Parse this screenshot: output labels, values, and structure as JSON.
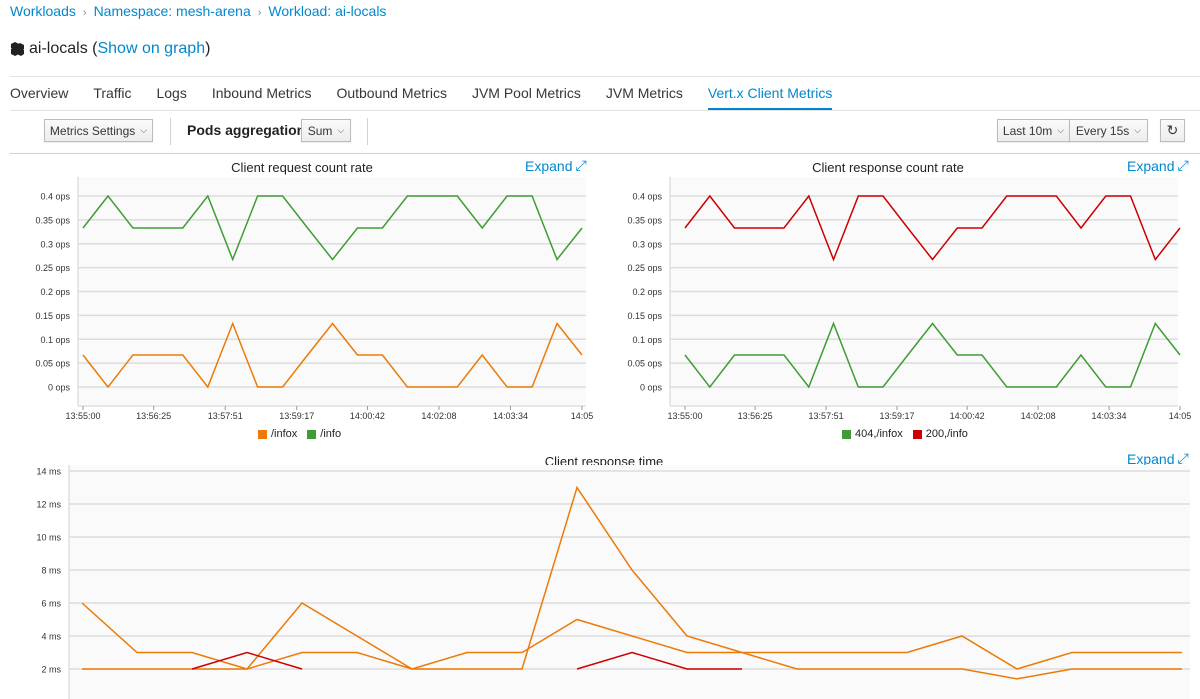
{
  "breadcrumb": [
    "Workloads",
    "Namespace: mesh-arena",
    "Workload: ai-locals"
  ],
  "title": {
    "name": "ai-locals",
    "open_paren": "(",
    "link": "Show on graph",
    "close_paren": ")",
    "icon": "cubes-icon"
  },
  "tabs": [
    {
      "label": "Overview",
      "active": false
    },
    {
      "label": "Traffic",
      "active": false
    },
    {
      "label": "Logs",
      "active": false
    },
    {
      "label": "Inbound Metrics",
      "active": false
    },
    {
      "label": "Outbound Metrics",
      "active": false
    },
    {
      "label": "JVM Pool Metrics",
      "active": false
    },
    {
      "label": "JVM Metrics",
      "active": false
    },
    {
      "label": "Vert.x Client Metrics",
      "active": true
    }
  ],
  "toolbar": {
    "metrics_settings": "Metrics Settings",
    "pods_aggregation_label": "Pods aggregation",
    "pods_aggregation_value": "Sum",
    "duration": "Last 10m",
    "refresh_interval": "Every 15s",
    "refresh_icon": "refresh-icon"
  },
  "expand_label": "Expand",
  "colors": {
    "accent": "#0088ce",
    "orange": "#ec7a08",
    "green": "#3f9c35",
    "red": "#cc0000"
  },
  "chart_data": [
    {
      "type": "line",
      "title": "Client request count rate",
      "x": [
        "13:55:00",
        "13:55:30",
        "13:56:00",
        "13:56:30",
        "13:57:00",
        "13:57:30",
        "13:58:00",
        "13:58:30",
        "13:59:00",
        "13:59:30",
        "14:00:00",
        "14:00:30",
        "14:01:00",
        "14:01:30",
        "14:02:00",
        "14:02:30",
        "14:03:00",
        "14:03:30",
        "14:04:00",
        "14:04:30",
        "14:05:00"
      ],
      "xticks": [
        "13:55:00",
        "13:56:25",
        "13:57:51",
        "13:59:17",
        "14:00:42",
        "14:02:08",
        "14:03:34",
        "14:05"
      ],
      "yticks": [
        "0 ops",
        "0.05 ops",
        "0.1 ops",
        "0.15 ops",
        "0.2 ops",
        "0.25 ops",
        "0.3 ops",
        "0.35 ops",
        "0.4 ops"
      ],
      "ylim": [
        0,
        0.4
      ],
      "unit": "ops",
      "grid": true,
      "legend": "bottom",
      "series": [
        {
          "name": "/infox",
          "color": "#ec7a08",
          "values": [
            0.067,
            0,
            0.067,
            0.067,
            0.067,
            0,
            0.133,
            0,
            0,
            0.067,
            0.133,
            0.067,
            0.067,
            0,
            0,
            0,
            0.067,
            0,
            0,
            0.133,
            0.067
          ]
        },
        {
          "name": "/info",
          "color": "#3f9c35",
          "values": [
            0.333,
            0.4,
            0.333,
            0.333,
            0.333,
            0.4,
            0.267,
            0.4,
            0.4,
            0.333,
            0.267,
            0.333,
            0.333,
            0.4,
            0.4,
            0.4,
            0.333,
            0.4,
            0.4,
            0.267,
            0.333
          ]
        }
      ]
    },
    {
      "type": "line",
      "title": "Client response count rate",
      "x": [
        "13:55:00",
        "13:55:30",
        "13:56:00",
        "13:56:30",
        "13:57:00",
        "13:57:30",
        "13:58:00",
        "13:58:30",
        "13:59:00",
        "13:59:30",
        "14:00:00",
        "14:00:30",
        "14:01:00",
        "14:01:30",
        "14:02:00",
        "14:02:30",
        "14:03:00",
        "14:03:30",
        "14:04:00",
        "14:04:30",
        "14:05:00"
      ],
      "xticks": [
        "13:55:00",
        "13:56:25",
        "13:57:51",
        "13:59:17",
        "14:00:42",
        "14:02:08",
        "14:03:34",
        "14:05"
      ],
      "yticks": [
        "0 ops",
        "0.05 ops",
        "0.1 ops",
        "0.15 ops",
        "0.2 ops",
        "0.25 ops",
        "0.3 ops",
        "0.35 ops",
        "0.4 ops"
      ],
      "ylim": [
        0,
        0.4
      ],
      "unit": "ops",
      "grid": true,
      "legend": "bottom",
      "series": [
        {
          "name": "404,/infox",
          "color": "#3f9c35",
          "values": [
            0.067,
            0,
            0.067,
            0.067,
            0.067,
            0,
            0.133,
            0,
            0,
            0.067,
            0.133,
            0.067,
            0.067,
            0,
            0,
            0,
            0.067,
            0,
            0,
            0.133,
            0.067
          ]
        },
        {
          "name": "200,/info",
          "color": "#cc0000",
          "values": [
            0.333,
            0.4,
            0.333,
            0.333,
            0.333,
            0.4,
            0.267,
            0.4,
            0.4,
            0.333,
            0.267,
            0.333,
            0.333,
            0.4,
            0.4,
            0.4,
            0.333,
            0.4,
            0.4,
            0.267,
            0.333
          ]
        }
      ]
    },
    {
      "type": "line",
      "title": "Client response time",
      "x": [
        "13:55:00",
        "13:55:30",
        "13:56:00",
        "13:56:30",
        "13:57:00",
        "13:57:30",
        "13:58:00",
        "13:58:30",
        "13:59:00",
        "13:59:30",
        "14:00:00",
        "14:00:30",
        "14:01:00",
        "14:01:30",
        "14:02:00",
        "14:02:30",
        "14:03:00",
        "14:03:30",
        "14:04:00",
        "14:04:30",
        "14:05:00"
      ],
      "yticks": [
        "2 ms",
        "4 ms",
        "6 ms",
        "8 ms",
        "10 ms",
        "12 ms",
        "14 ms"
      ],
      "ylim": [
        0,
        14
      ],
      "unit": "ms",
      "grid": true,
      "series": [
        {
          "color": "#ec7a08",
          "values": [
            6,
            3,
            3,
            2,
            6,
            4,
            2,
            2,
            2,
            13,
            8,
            4,
            3,
            2,
            2,
            2,
            2,
            1.4,
            2,
            2,
            2
          ]
        },
        {
          "color": "#ec7a08",
          "values": [
            2,
            2,
            2,
            2,
            3,
            3,
            2,
            3,
            3,
            5,
            4,
            3,
            3,
            3,
            3,
            3,
            4,
            2,
            3,
            3,
            3
          ]
        },
        {
          "color": "#cc0000",
          "values": [
            null,
            null,
            2,
            3,
            2,
            null,
            null,
            null,
            null,
            2,
            3,
            2,
            2,
            null,
            null,
            null,
            null,
            null,
            null,
            null,
            null
          ]
        }
      ]
    }
  ]
}
